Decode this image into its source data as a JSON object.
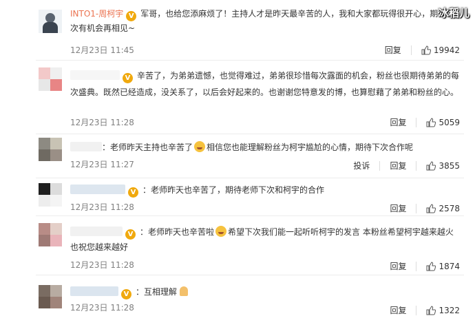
{
  "watermark": "冰稻儿",
  "labels": {
    "reply": "回复",
    "report": "投诉"
  },
  "colors": {
    "username": "#eb7350",
    "vip_badge": "#f0a90e",
    "time": "#808080"
  },
  "comments": [
    {
      "username": "INTO1-周柯宇",
      "verified": true,
      "text": "军哥，也给您添麻烦了！主持人才是昨天最辛苦的人，我和大家都玩得很开心，期待下次有机会再相见~",
      "time": "12月23日 11:45",
      "likes": "19942"
    },
    {
      "username": "",
      "verified": true,
      "text": "辛苦了，为弟弟遗憾，也觉得难过，弟弟很珍惜每次露面的机会，粉丝也很期待弟弟的每次盛典。既然已经造成，没关系了，以后会好起来的。也谢谢您特意发的博，也算慰藉了弟弟和粉丝的心。",
      "time": "12月23日 11:28",
      "likes": "5059"
    },
    {
      "username": "",
      "verified": false,
      "text_a": "：老师昨天主持也辛苦了",
      "text_b": "相信您也能理解粉丝为柯宇尴尬的心情，期待下次合作呢",
      "time": "12月23日 11:27",
      "likes": "3855",
      "show_report": true
    },
    {
      "username": "",
      "verified": true,
      "text": "：老师昨天也辛苦了，期待老师下次和柯宇的合作",
      "time": "12月23日 11:28",
      "likes": "2578"
    },
    {
      "username": "",
      "verified": true,
      "text_a": "：老师昨天也辛苦啦",
      "text_b": "希望下次我们能一起听听柯宇的发言 本粉丝希望柯宇越来越火 也祝您越来越好",
      "time": "12月23日 11:28",
      "likes": "1874"
    },
    {
      "username": "",
      "verified": true,
      "text": "：互相理解",
      "time": "12月23日 11:28",
      "likes": "1322"
    }
  ]
}
